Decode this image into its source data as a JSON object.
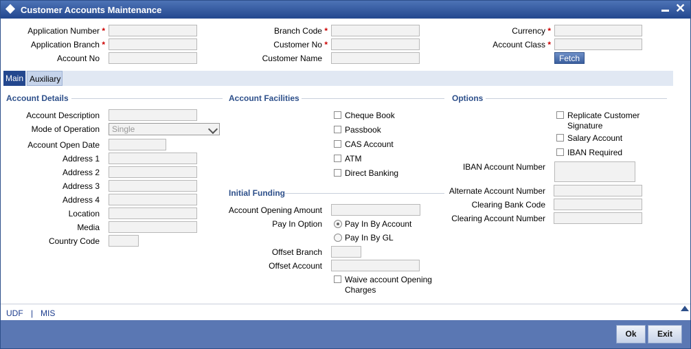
{
  "window": {
    "title": "Customer Accounts Maintenance"
  },
  "header_fields": {
    "application_number": {
      "label": "Application Number",
      "required": "*",
      "value": ""
    },
    "application_branch": {
      "label": "Application Branch",
      "required": "*",
      "value": ""
    },
    "account_no": {
      "label": "Account No",
      "value": ""
    },
    "branch_code": {
      "label": "Branch Code",
      "required": "*",
      "value": ""
    },
    "customer_no": {
      "label": "Customer No",
      "required": "*",
      "value": ""
    },
    "customer_name": {
      "label": "Customer Name",
      "value": ""
    },
    "currency": {
      "label": "Currency",
      "required": "*",
      "value": ""
    },
    "account_class": {
      "label": "Account Class",
      "required": "*",
      "value": ""
    },
    "fetch_label": "Fetch"
  },
  "tabs": [
    {
      "label": "Main",
      "active": true
    },
    {
      "label": "Auxiliary",
      "active": false
    }
  ],
  "account_details": {
    "section_title": "Account Details",
    "account_description": "Account Description",
    "mode_of_operation": "Mode of Operation",
    "mode_value": "Single",
    "account_open_date": "Account Open Date",
    "address1": "Address 1",
    "address2": "Address 2",
    "address3": "Address 3",
    "address4": "Address 4",
    "location": "Location",
    "media": "Media",
    "country_code": "Country Code"
  },
  "account_facilities": {
    "section_title": "Account Facilities",
    "items": [
      "Cheque Book",
      "Passbook",
      "CAS Account",
      "ATM",
      "Direct Banking"
    ]
  },
  "initial_funding": {
    "section_title": "Initial Funding",
    "account_opening_amount": "Account Opening Amount",
    "pay_in_option": "Pay In Option",
    "pay_in_by_account": "Pay In By Account",
    "pay_in_by_gl": "Pay In By GL",
    "offset_branch": "Offset Branch",
    "offset_account": "Offset Account",
    "waive_line1": "Waive account Opening",
    "waive_line2": "Charges"
  },
  "options": {
    "section_title": "Options",
    "replicate_line1": "Replicate Customer",
    "replicate_line2": "Signature",
    "salary_account": "Salary Account",
    "iban_required": "IBAN Required",
    "iban_account_number": "IBAN Account Number",
    "alternate_account_number": "Alternate Account Number",
    "clearing_bank_code": "Clearing Bank Code",
    "clearing_account_number": "Clearing Account Number"
  },
  "bottom_links": {
    "udf": "UDF",
    "separator": "|",
    "mis": "MIS"
  },
  "footer": {
    "ok": "Ok",
    "exit": "Exit"
  }
}
